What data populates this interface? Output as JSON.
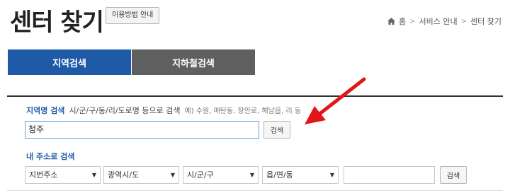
{
  "header": {
    "title": "센터 찾기",
    "guide_button": "이용방법 안내"
  },
  "breadcrumb": {
    "items": [
      "홈",
      "서비스 안내",
      "센터 찾기"
    ]
  },
  "tabs": [
    {
      "label": "지역검색",
      "active": true
    },
    {
      "label": "지하철검색",
      "active": false
    }
  ],
  "region_search": {
    "title": "지역명 검색",
    "description": "시/군/구/동/리/도로명 등으로 검색",
    "example": "예) 수원, 매탄동, 장안로, 해남읍, 리 등",
    "input_value": "청주",
    "button": "검색"
  },
  "address_search": {
    "title": "내 주소로 검색",
    "selects": [
      "지번주소",
      "광역시/도",
      "시/군/구",
      "읍/면/동"
    ],
    "input_value": "",
    "button": "검색"
  },
  "colors": {
    "accent": "#1f5aa8",
    "inactive_tab": "#5f5f5f",
    "annotation_arrow": "#e3151a"
  }
}
